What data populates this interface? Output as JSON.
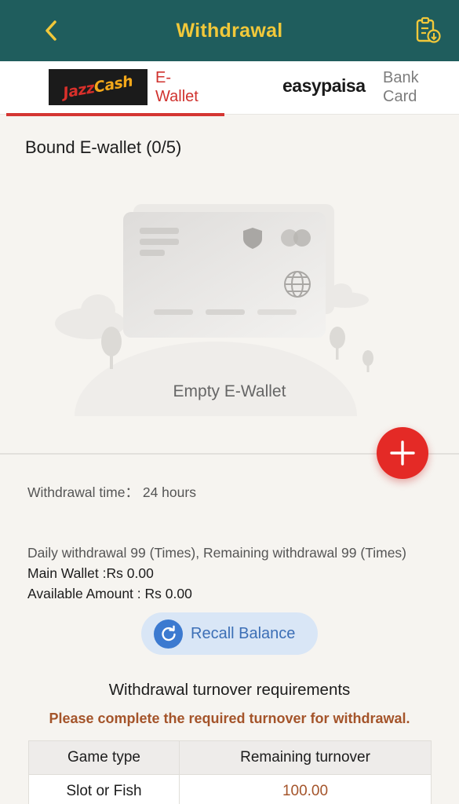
{
  "header": {
    "title": "Withdrawal",
    "back_icon": "chevron-left-icon",
    "records_icon": "clipboard-download-icon",
    "background_color": "#1f5d5d",
    "title_color": "#f1c83a"
  },
  "tabs": [
    {
      "logo_text_a": "Jazz",
      "logo_text_b": "Cash",
      "label": "E-Wallet",
      "active": true
    },
    {
      "logo_text": "easypaisa",
      "label": "Bank Card",
      "active": false
    }
  ],
  "bound": {
    "title": "Bound E-wallet (0/5)",
    "empty_label": "Empty E-Wallet"
  },
  "add_button": {
    "icon": "plus-icon",
    "color": "#e42a26"
  },
  "info": {
    "withdrawal_time": "Withdrawal time： 24 hours",
    "daily_limit": "Daily withdrawal 99 (Times), Remaining withdrawal 99 (Times)",
    "main_wallet": "Main Wallet :Rs 0.00",
    "available_amount": "Available Amount : Rs 0.00"
  },
  "recall": {
    "label": "Recall Balance",
    "icon": "refresh-icon"
  },
  "turnover": {
    "title": "Withdrawal turnover requirements",
    "note": "Please complete the required turnover for withdrawal.",
    "columns": [
      "Game type",
      "Remaining turnover"
    ],
    "rows": [
      {
        "game_type": "Slot or Fish",
        "remaining": "100.00"
      }
    ]
  }
}
